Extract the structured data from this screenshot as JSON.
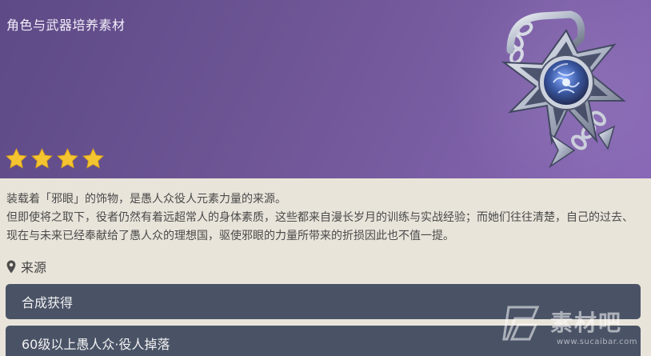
{
  "header": {
    "category": "角色与武器培养素材",
    "rarity_stars": 4,
    "item_icon": "evil-eye-insignia-icon"
  },
  "description": {
    "line1": "装载着「邪眼」的饰物，是愚人众役人元素力量的来源。",
    "line2": "但即使将之取下，役者仍然有着远超常人的身体素质，这些都来自漫长岁月的训练与实战经验；而她们往往清楚，自己的过去、现在与未来已经奉献给了愚人众的理想国，驱使邪眼的力量所带来的折损因此也不值一提。"
  },
  "source": {
    "heading": "来源",
    "icon": "location-pin-icon",
    "items": [
      "合成获得",
      "60级以上愚人众·役人掉落"
    ]
  },
  "watermark": {
    "brand": "素材吧",
    "url": "www.sucaibar.com"
  },
  "colors": {
    "header_start": "#5d4a86",
    "header_end": "#8867b6",
    "star": "#f5c531",
    "button_bg": "#4a5366",
    "page_bg": "#e9e4da"
  }
}
